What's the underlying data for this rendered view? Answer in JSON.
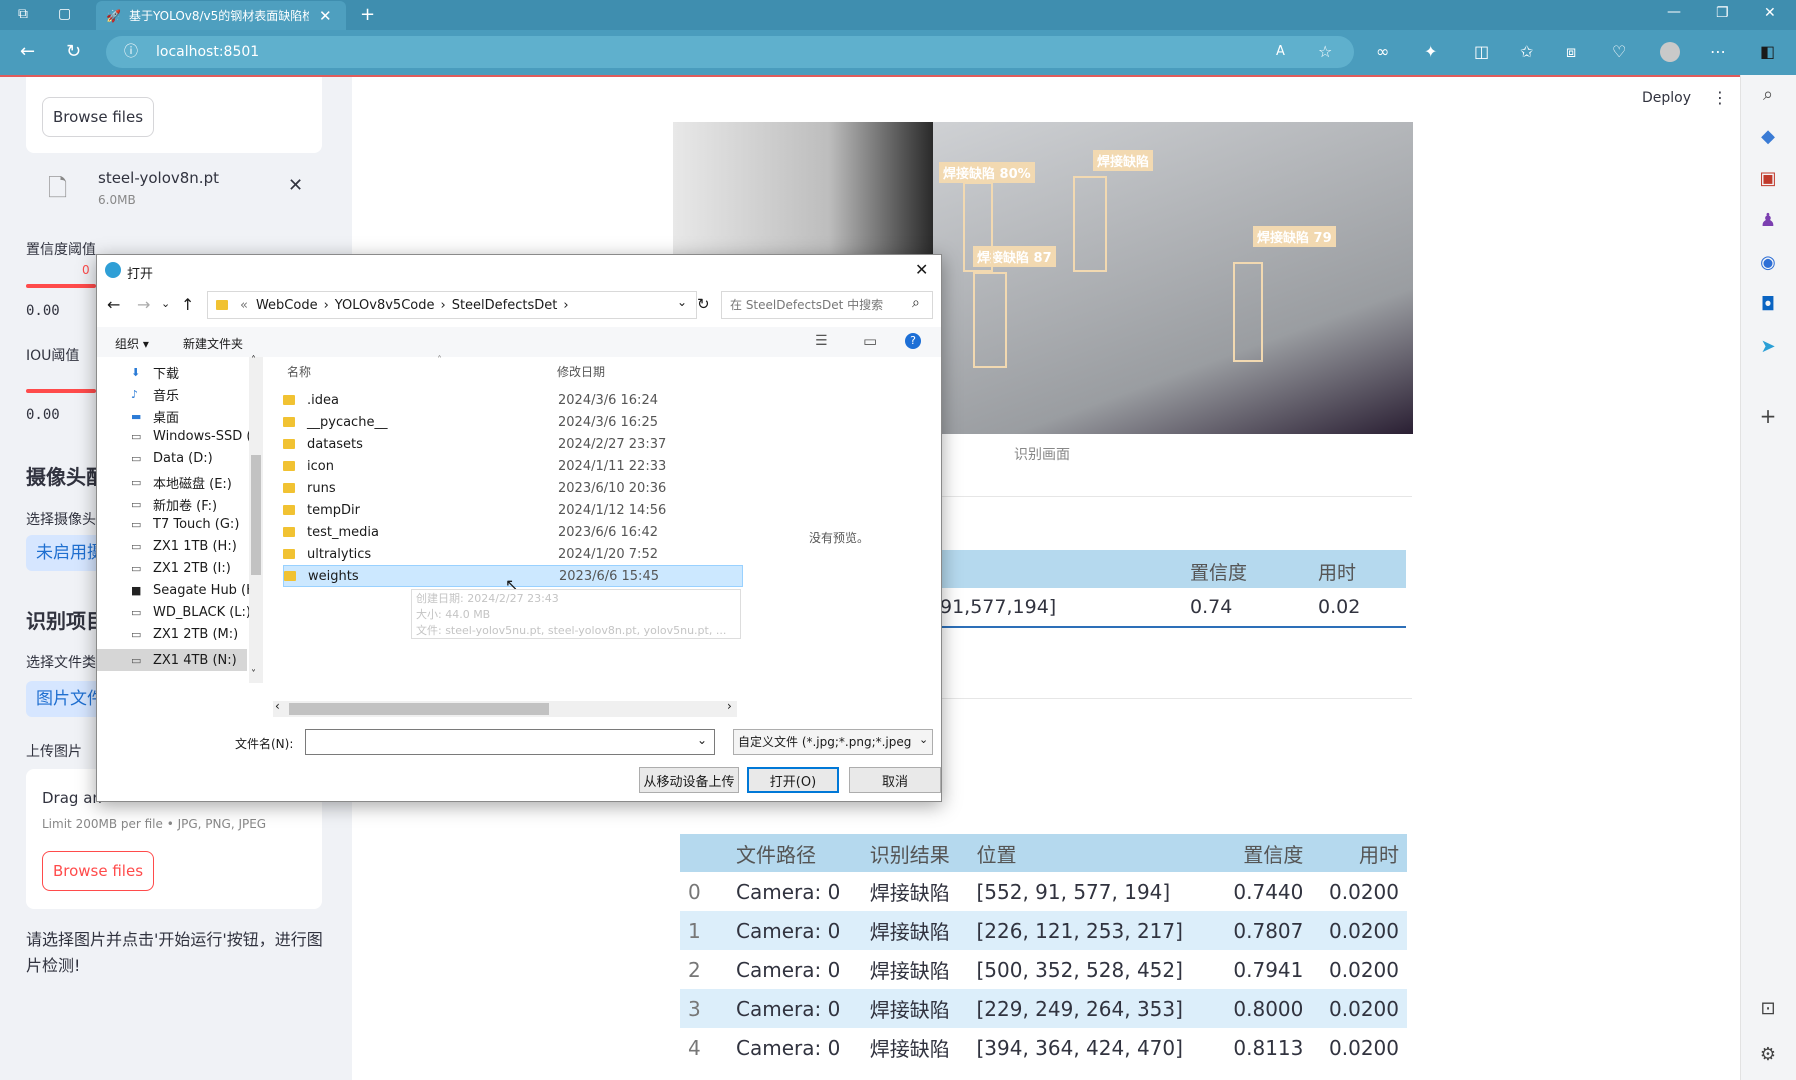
{
  "browser": {
    "tab_title": "基于YOLOv8/v5的钢材表面缺陷检",
    "url": "localhost:8501"
  },
  "sidebar": {
    "browse_top_label": "Browse files",
    "file_name": "steel-yolov8n.pt",
    "file_size": "6.0MB",
    "confidence_label": "置信度阈值",
    "confidence_value": "0.00",
    "iou_label": "IOU阈值",
    "iou_value": "0.00",
    "camera_header": "摄像头配",
    "camera_select_label": "选择摄像头",
    "camera_value": "未启用摄",
    "task_header": "识别项目",
    "file_type_label": "选择文件类",
    "file_type_value": "图片文件",
    "upload_label": "上传图片",
    "drag_text": "Drag an",
    "limit_text": "Limit 200MB per file • JPG, PNG, JPEG",
    "browse_bottom_label": "Browse files",
    "hint_text": "请选择图片并点击'开始运行'按钮，进行图片检测!"
  },
  "main": {
    "deploy_label": "Deploy",
    "image_labels": [
      "焊接缺陷 80%",
      "焊接缺陷",
      "焊接缺陷 87",
      "焊接缺陷 79"
    ],
    "image_caption": "识别画面",
    "result_table": {
      "columns": [
        "置信度",
        "用时"
      ],
      "row": {
        "position_tail": "91,577,194]",
        "confidence": "0.74",
        "time": "0.02"
      }
    },
    "log_table": {
      "columns": [
        "",
        "文件路径",
        "识别结果",
        "位置",
        "置信度",
        "用时"
      ],
      "rows": [
        {
          "idx": "0",
          "path": "Camera: 0",
          "result": "焊接缺陷",
          "pos": "[552, 91, 577, 194]",
          "conf": "0.7440",
          "time": "0.0200"
        },
        {
          "idx": "1",
          "path": "Camera: 0",
          "result": "焊接缺陷",
          "pos": "[226, 121, 253, 217]",
          "conf": "0.7807",
          "time": "0.0200"
        },
        {
          "idx": "2",
          "path": "Camera: 0",
          "result": "焊接缺陷",
          "pos": "[500, 352, 528, 452]",
          "conf": "0.7941",
          "time": "0.0200"
        },
        {
          "idx": "3",
          "path": "Camera: 0",
          "result": "焊接缺陷",
          "pos": "[229, 249, 264, 353]",
          "conf": "0.8000",
          "time": "0.0200"
        },
        {
          "idx": "4",
          "path": "Camera: 0",
          "result": "焊接缺陷",
          "pos": "[394, 364, 424, 470]",
          "conf": "0.8113",
          "time": "0.0200"
        }
      ]
    }
  },
  "dialog": {
    "title": "打开",
    "breadcrumb": [
      "WebCode",
      "YOLOv8v5Code",
      "SteelDefectsDet"
    ],
    "search_placeholder": "在 SteelDefectsDet 中搜索",
    "organize_label": "组织 ▾",
    "new_folder_label": "新建文件夹",
    "nav_items": [
      "下载",
      "音乐",
      "桌面",
      "Windows-SSD (C",
      "Data (D:)",
      "本地磁盘 (E:)",
      "新加卷 (F:)",
      "T7 Touch (G:)",
      "ZX1 1TB (H:)",
      "ZX1 2TB (I:)",
      "Seagate Hub (K:",
      "WD_BLACK (L:)",
      "ZX1 2TB (M:)",
      "ZX1 4TB (N:)"
    ],
    "col_name": "名称",
    "col_date": "修改日期",
    "files": [
      {
        "name": ".idea",
        "date": "2024/3/6 16:24"
      },
      {
        "name": "__pycache__",
        "date": "2024/3/6 16:25"
      },
      {
        "name": "datasets",
        "date": "2024/2/27 23:37"
      },
      {
        "name": "icon",
        "date": "2024/1/11 22:33"
      },
      {
        "name": "runs",
        "date": "2023/6/10 20:36"
      },
      {
        "name": "tempDir",
        "date": "2024/1/12 14:56"
      },
      {
        "name": "test_media",
        "date": "2023/6/6 16:42"
      },
      {
        "name": "ultralytics",
        "date": "2024/1/20 7:52"
      },
      {
        "name": "weights",
        "date": "2023/6/6 15:45"
      }
    ],
    "no_preview": "没有预览。",
    "tooltip": [
      "创建日期: 2024/2/27 23:43",
      "大小: 44.0 MB",
      "文件: steel-yolov5nu.pt, steel-yolov8n.pt, yolov5nu.pt, ..."
    ],
    "filename_label": "文件名(N):",
    "filename_value": "",
    "filter_label": "自定义文件 (*.jpg;*.png;*.jpeg",
    "upload_mobile_label": "从移动设备上传",
    "open_label": "打开(O)",
    "cancel_label": "取消"
  }
}
